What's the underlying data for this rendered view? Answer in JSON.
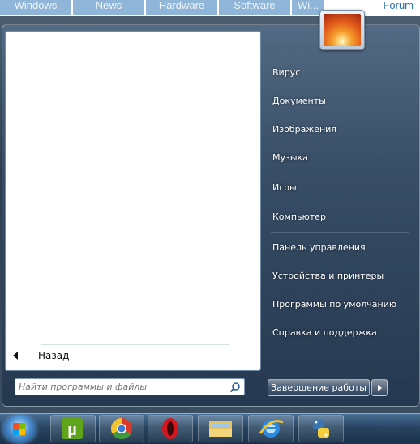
{
  "web_nav": {
    "tabs": [
      "Windows",
      "News",
      "Hardware",
      "Software",
      "Wi..."
    ],
    "forum": "Forum"
  },
  "start_menu": {
    "right_items": [
      "Вирус",
      "Документы",
      "Изображения",
      "Музыка",
      "Игры",
      "Компьютер",
      "Панель управления",
      "Устройства и принтеры",
      "Программы по умолчанию",
      "Справка и поддержка"
    ],
    "back_label": "Назад",
    "search_placeholder": "Найти программы и файлы",
    "shutdown_label": "Завершение работы"
  },
  "taskbar": {
    "icons": [
      "utorrent-icon",
      "chrome-icon",
      "opera-icon",
      "explorer-icon",
      "ie-icon",
      "python-icon"
    ]
  },
  "colors": {
    "accent": "#2d6fb3",
    "taskbar": "#27435f"
  }
}
